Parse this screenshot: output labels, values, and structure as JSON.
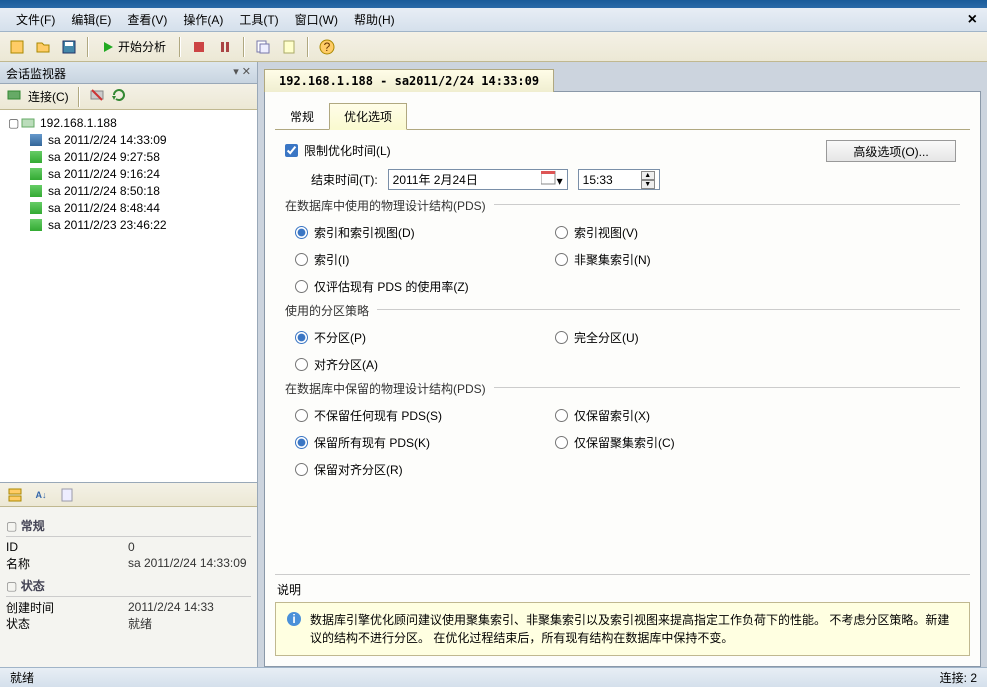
{
  "menubar": {
    "items": [
      "文件(F)",
      "编辑(E)",
      "查看(V)",
      "操作(A)",
      "工具(T)",
      "窗口(W)",
      "帮助(H)"
    ]
  },
  "toolbar": {
    "start_analysis": "开始分析"
  },
  "left": {
    "panel_title": "会话监视器",
    "connect_label": "连接(C)",
    "server": "192.168.1.188",
    "sessions": [
      "sa 2011/2/24 14:33:09",
      "sa 2011/2/24 9:27:58",
      "sa 2011/2/24 9:16:24",
      "sa 2011/2/24 8:50:18",
      "sa 2011/2/24 8:48:44",
      "sa 2011/2/23 23:46:22"
    ],
    "props": {
      "cat1": "常规",
      "id_k": "ID",
      "id_v": "0",
      "name_k": "名称",
      "name_v": "sa 2011/2/24 14:33:09",
      "cat2": "状态",
      "ctime_k": "创建时间",
      "ctime_v": "2011/2/24 14:33",
      "state_k": "状态",
      "state_v": "就绪"
    }
  },
  "doc": {
    "tab_title": "192.168.1.188 - sa2011/2/24 14:33:09",
    "tabs": {
      "general": "常规",
      "tuning": "优化选项"
    },
    "limit_time_label": "限制优化时间(L)",
    "adv_button": "高级选项(O)...",
    "end_time_label": "结束时间(T):",
    "date_value": "2011年 2月24日",
    "time_value": "15:33",
    "group_pds_use": "在数据库中使用的物理设计结构(PDS)",
    "opts_pds": {
      "a": "索引和索引视图(D)",
      "b": "索引视图(V)",
      "c": "索引(I)",
      "d": "非聚集索引(N)",
      "e": "仅评估现有 PDS 的使用率(Z)"
    },
    "group_partition": "使用的分区策略",
    "opts_part": {
      "a": "不分区(P)",
      "b": "完全分区(U)",
      "c": "对齐分区(A)"
    },
    "group_pds_keep": "在数据库中保留的物理设计结构(PDS)",
    "opts_keep": {
      "a": "不保留任何现有 PDS(S)",
      "b": "仅保留索引(X)",
      "c": "保留所有现有 PDS(K)",
      "d": "仅保留聚集索引(C)",
      "e": "保留对齐分区(R)"
    },
    "desc_label": "说明",
    "desc_text": "数据库引擎优化顾问建议使用聚集索引、非聚集索引以及索引视图来提高指定工作负荷下的性能。 不考虑分区策略。新建议的结构不进行分区。 在优化过程结束后，所有现有结构在数据库中保持不变。"
  },
  "statusbar": {
    "left": "就绪",
    "right": "连接: 2"
  }
}
